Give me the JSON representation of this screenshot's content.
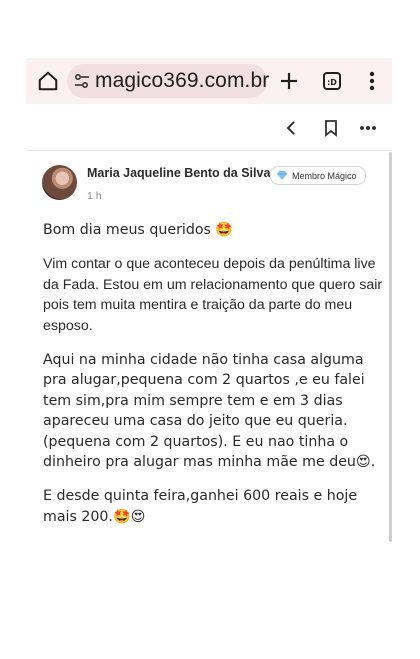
{
  "browser": {
    "url": "magico369.com.br",
    "icons": [
      "home-icon",
      "tune-icon",
      "plus-icon",
      "tab-switcher-icon",
      "kebab-menu-icon"
    ],
    "tab_count": ":D"
  },
  "toolbar": {
    "icons": [
      "back-chevron-icon",
      "bookmark-icon",
      "more-horizontal-icon"
    ]
  },
  "post": {
    "author": "Maria Jaqueline Bento da Silva",
    "badge_icon": "gem-icon",
    "badge_label": "Membro Mágico",
    "time": "1 h",
    "paragraphs": [
      "Bom dia meus queridos 🤩",
      "Vim contar o que aconteceu depois da penúltima live da Fada. Estou em um relacionamento que quero sair pois tem muita mentira e traição da parte do meu esposo.",
      "Aqui na minha cidade não tinha casa alguma pra alugar,pequena com 2 quartos ,e eu falei tem sim,pra mim sempre tem e em 3 dias apareceu uma casa do jeito que eu queria.(pequena com 2 quartos). E eu nao tinha o dinheiro pra alugar mas minha mãe me deu😍.",
      "E desde quinta feira,ganhei 600 reais e hoje mais 200.🤩😍"
    ]
  },
  "colors": {
    "topbar_bg": "#fbf1f2",
    "url_pill_bg": "#f1dfe2",
    "text": "#2a2a2a",
    "muted": "#8a8a8a"
  }
}
